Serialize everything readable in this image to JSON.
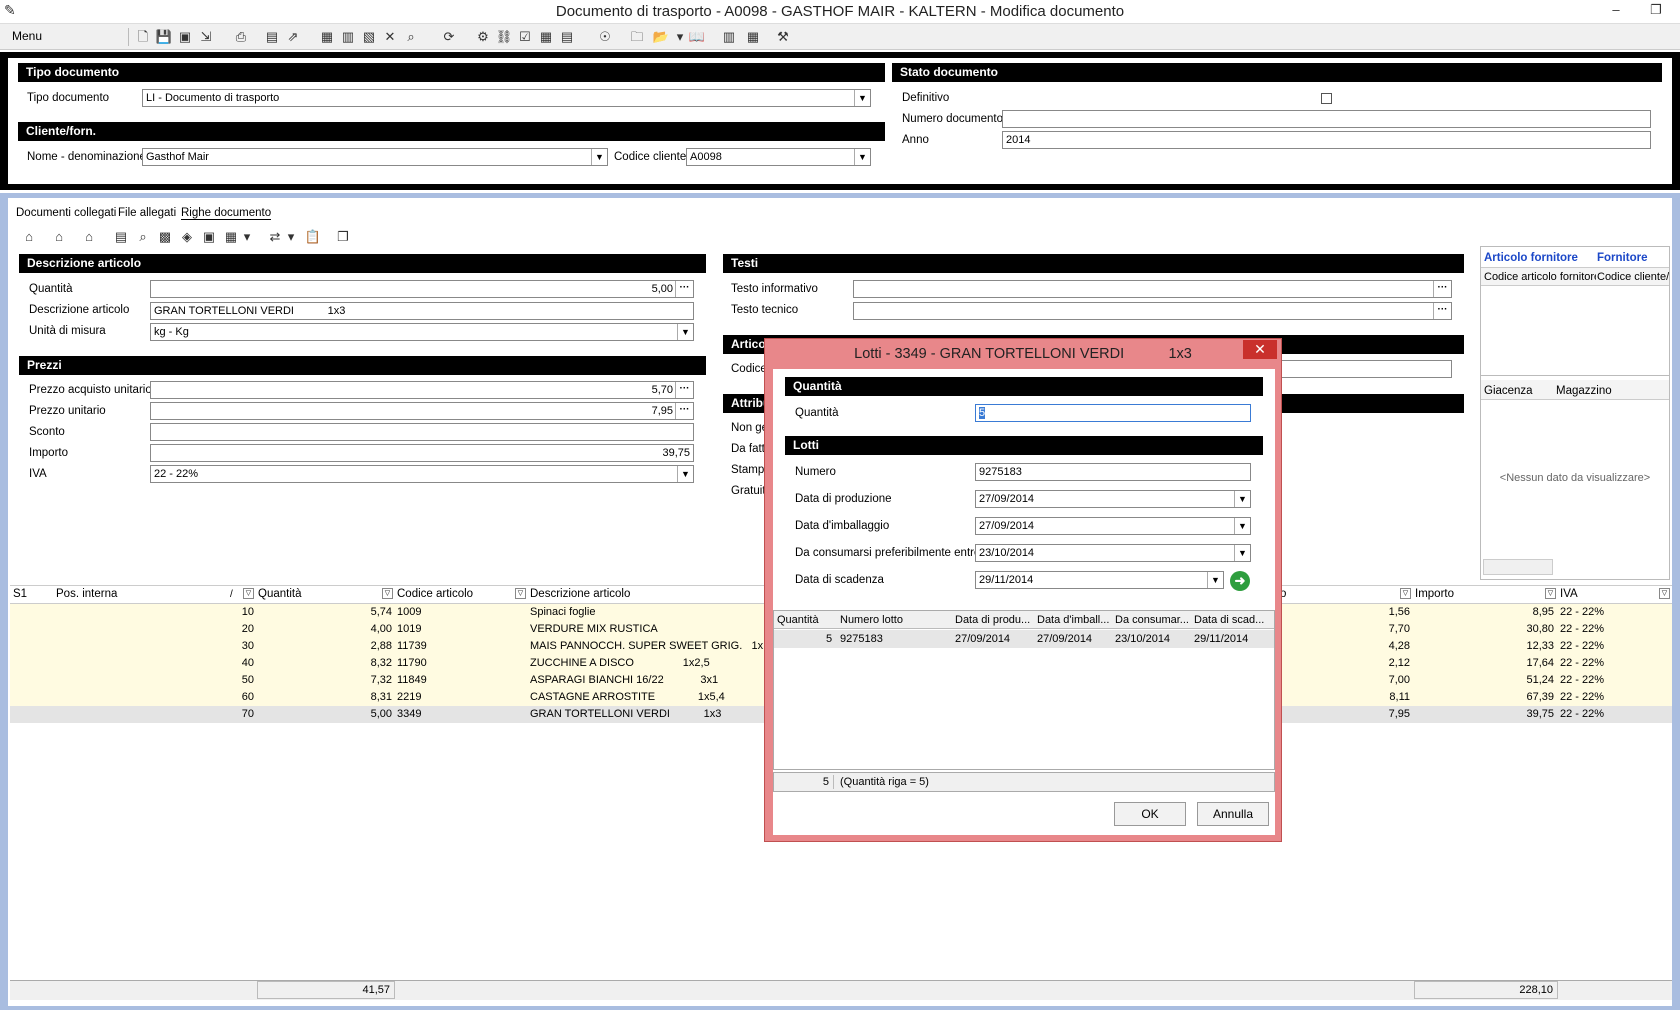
{
  "window": {
    "title": "Documento di trasporto - A0098 - GASTHOF MAIR - KALTERN - Modifica documento"
  },
  "menu": {
    "label": "Menu"
  },
  "tipo_documento": {
    "header": "Tipo documento",
    "label": "Tipo documento",
    "value": "LI - Documento di trasporto"
  },
  "cliente": {
    "header": "Cliente/forn.",
    "nome_label": "Nome - denominazione",
    "nome_value": "Gasthof Mair",
    "codice_label": "Codice cliente",
    "codice_value": "A0098"
  },
  "stato": {
    "header": "Stato documento",
    "definitivo_label": "Definitivo",
    "numero_label": "Numero documento",
    "numero_value": "",
    "anno_label": "Anno",
    "anno_value": "2014"
  },
  "tabs": [
    "Documenti collegati",
    "File allegati",
    "Righe documento"
  ],
  "descrizione": {
    "header": "Descrizione articolo",
    "quantita_label": "Quantità",
    "quantita_value": "5,00",
    "desc_label": "Descrizione articolo",
    "desc_value": "GRAN TORTELLONI VERDI           1x3",
    "um_label": "Unità di misura",
    "um_value": "kg - Kg"
  },
  "prezzi": {
    "header": "Prezzi",
    "acquisto_label": "Prezzo acquisto unitario",
    "acquisto_value": "5,70",
    "unitario_label": "Prezzo unitario",
    "unitario_value": "7,95",
    "sconto_label": "Sconto",
    "sconto_value": "",
    "importo_label": "Importo",
    "importo_value": "39,75",
    "iva_label": "IVA",
    "iva_value": "22 - 22%"
  },
  "testi": {
    "header": "Testi",
    "informativo_label": "Testo informativo",
    "tecnico_label": "Testo tecnico"
  },
  "articolo_hdr": "Artico",
  "codice_lbl": "Codice",
  "attrib": {
    "header": "Attribu",
    "l1": "Non ge",
    "l2": "Da fatt",
    "l3": "Stampa",
    "l4": "Gratuit"
  },
  "fornitore_panel": {
    "h1": "Articolo fornitore",
    "h2": "Fornitore",
    "c1": "Codice articolo fornitore",
    "c2": "Codice cliente/"
  },
  "giacenza_panel": {
    "h1": "Giacenza",
    "h2": "Magazzino",
    "empty": "<Nessun dato da visualizzare>"
  },
  "grid": {
    "headers": {
      "s1": "S1",
      "pos": "Pos. interna",
      "qta": "Quantità",
      "cod": "Codice articolo",
      "desc": "Descrizione articolo",
      "o": "o",
      "importo": "Importo",
      "iva": "IVA"
    },
    "rows": [
      {
        "pos": "10",
        "qta": "5,74",
        "cod": "1009",
        "desc": "Spinaci foglie",
        "prezzo": "1,56",
        "importo": "8,95",
        "iva": "22 - 22%"
      },
      {
        "pos": "20",
        "qta": "4,00",
        "cod": "1019",
        "desc": "VERDURE MIX RUSTICA",
        "prezzo": "7,70",
        "importo": "30,80",
        "iva": "22 - 22%"
      },
      {
        "pos": "30",
        "qta": "2,88",
        "cod": "11739",
        "desc": "MAIS PANNOCCH. SUPER SWEET GRIG.   1x1",
        "prezzo": "4,28",
        "importo": "12,33",
        "iva": "22 - 22%"
      },
      {
        "pos": "40",
        "qta": "8,32",
        "cod": "11790",
        "desc": "ZUCCHINE A DISCO                1x2,5",
        "prezzo": "2,12",
        "importo": "17,64",
        "iva": "22 - 22%"
      },
      {
        "pos": "50",
        "qta": "7,32",
        "cod": "11849",
        "desc": "ASPARAGI BIANCHI 16/22            3x1",
        "prezzo": "7,00",
        "importo": "51,24",
        "iva": "22 - 22%"
      },
      {
        "pos": "60",
        "qta": "8,31",
        "cod": "2219",
        "desc": "CASTAGNE ARROSTITE              1x5,4",
        "prezzo": "8,11",
        "importo": "67,39",
        "iva": "22 - 22%"
      },
      {
        "pos": "70",
        "qta": "5,00",
        "cod": "3349",
        "desc": "GRAN TORTELLONI VERDI           1x3",
        "prezzo": "7,95",
        "importo": "39,75",
        "iva": "22 - 22%"
      }
    ],
    "total_qta": "41,57",
    "total_importo": "228,10"
  },
  "dialog": {
    "title": "Lotti - 3349 - GRAN TORTELLONI VERDI           1x3",
    "quantita_header": "Quantità",
    "quantita_label": "Quantità",
    "quantita_value": "5",
    "lotti_header": "Lotti",
    "numero_label": "Numero",
    "numero_value": "9275183",
    "prod_label": "Data di produzione",
    "prod_value": "27/09/2014",
    "imb_label": "Data d'imballaggio",
    "imb_value": "27/09/2014",
    "cons_label": "Da consumarsi preferibilmente entro",
    "cons_value": "23/10/2014",
    "scad_label": "Data di scadenza",
    "scad_value": "29/11/2014",
    "table_headers": [
      "Quantità",
      "Numero lotto",
      "Data di produ...",
      "Data d'imball...",
      "Da consumar...",
      "Data di scad..."
    ],
    "table_row": [
      "5",
      "9275183",
      "27/09/2014",
      "27/09/2014",
      "23/10/2014",
      "29/11/2014"
    ],
    "footer_qta": "5",
    "footer_note": "(Quantità riga = 5)",
    "ok_label": "OK",
    "cancel_label": "Annulla"
  }
}
